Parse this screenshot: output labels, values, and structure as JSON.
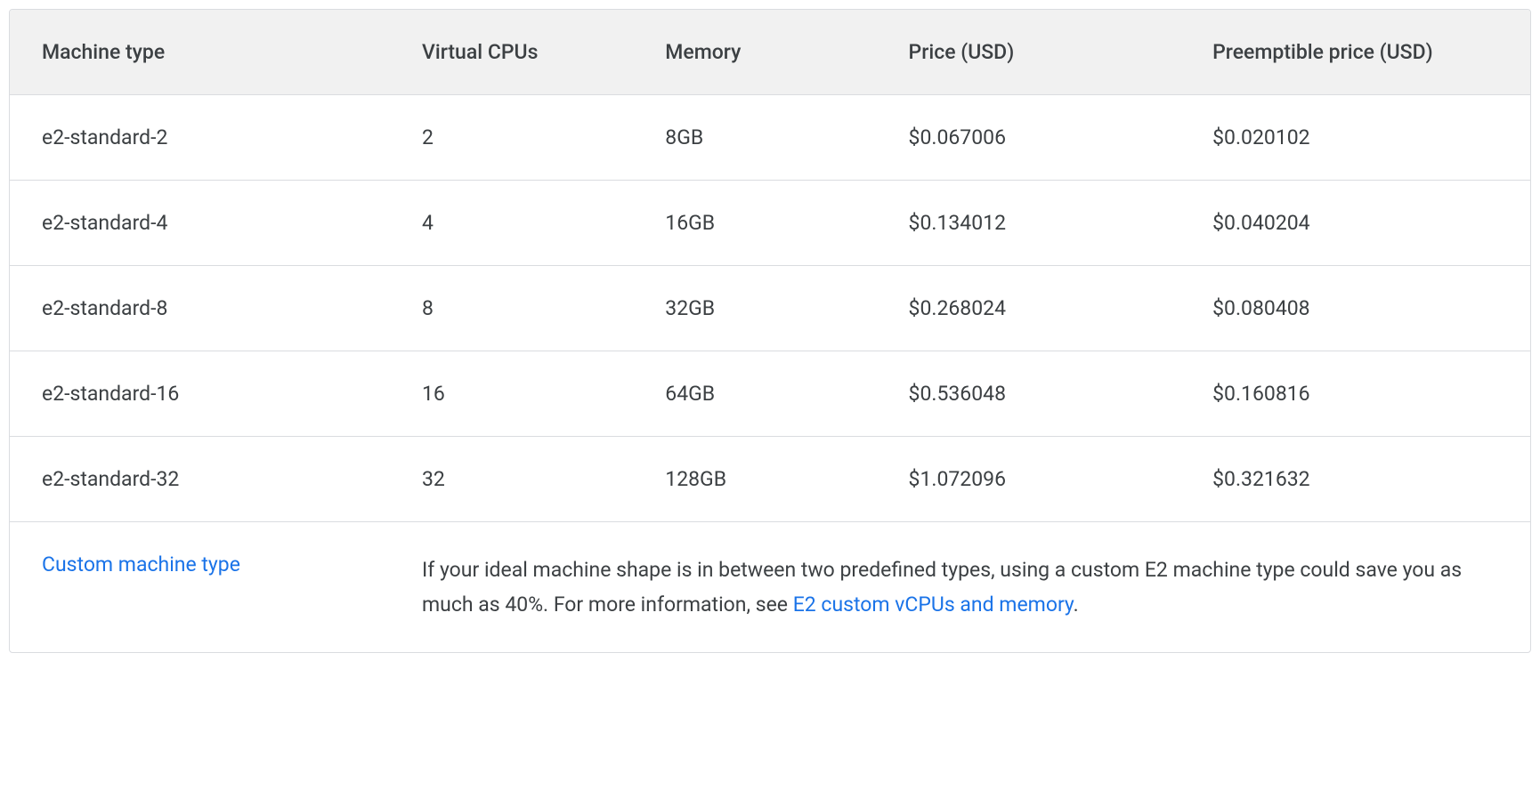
{
  "table": {
    "headers": {
      "machine_type": "Machine type",
      "vcpu": "Virtual CPUs",
      "memory": "Memory",
      "price": "Price (USD)",
      "preemptible": "Preemptible price (USD)"
    },
    "rows": [
      {
        "machine_type": "e2-standard-2",
        "vcpu": "2",
        "memory": "8GB",
        "price": "$0.067006",
        "preemptible": "$0.020102"
      },
      {
        "machine_type": "e2-standard-4",
        "vcpu": "4",
        "memory": "16GB",
        "price": "$0.134012",
        "preemptible": "$0.040204"
      },
      {
        "machine_type": "e2-standard-8",
        "vcpu": "8",
        "memory": "32GB",
        "price": "$0.268024",
        "preemptible": "$0.080408"
      },
      {
        "machine_type": "e2-standard-16",
        "vcpu": "16",
        "memory": "64GB",
        "price": "$0.536048",
        "preemptible": "$0.160816"
      },
      {
        "machine_type": "e2-standard-32",
        "vcpu": "32",
        "memory": "128GB",
        "price": "$1.072096",
        "preemptible": "$0.321632"
      }
    ],
    "footer": {
      "link_label": "Custom machine type",
      "description_part1": "If your ideal machine shape is in between two predefined types, using a custom E2 machine type could save you as much as 40%. For more information, see ",
      "inline_link": "E2 custom vCPUs and memory",
      "description_part2": "."
    }
  },
  "chart_data": {
    "type": "table",
    "title": "E2 standard machine types pricing",
    "columns": [
      "Machine type",
      "Virtual CPUs",
      "Memory",
      "Price (USD)",
      "Preemptible price (USD)"
    ],
    "rows": [
      [
        "e2-standard-2",
        2,
        "8GB",
        0.067006,
        0.020102
      ],
      [
        "e2-standard-4",
        4,
        "16GB",
        0.134012,
        0.040204
      ],
      [
        "e2-standard-8",
        8,
        "32GB",
        0.268024,
        0.080408
      ],
      [
        "e2-standard-16",
        16,
        "64GB",
        0.536048,
        0.160816
      ],
      [
        "e2-standard-32",
        32,
        "128GB",
        1.072096,
        0.321632
      ]
    ]
  }
}
